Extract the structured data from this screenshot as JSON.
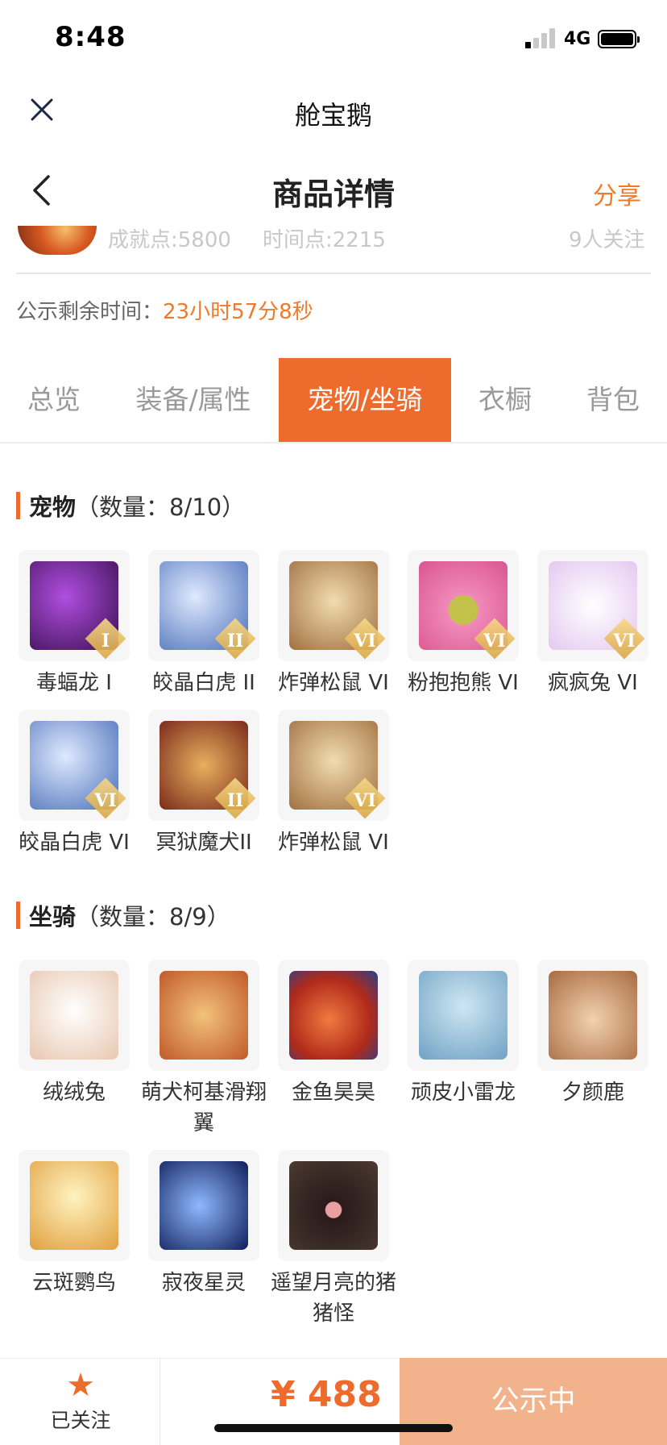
{
  "status_bar": {
    "time": "8:48",
    "network": "4G"
  },
  "app_bar": {
    "title": "舱宝鹅"
  },
  "nav": {
    "title": "商品详情",
    "share": "分享"
  },
  "peek_row": {
    "achievement": "成就点:5800",
    "timepoint": "时间点:2215",
    "followers": "9人关注"
  },
  "publicity": {
    "label": "公示剩余时间：",
    "remaining": "23小时57分8秒"
  },
  "tabs": [
    {
      "label": "总览"
    },
    {
      "label": "装备/属性"
    },
    {
      "label": "宠物/坐骑"
    },
    {
      "label": "衣橱"
    },
    {
      "label": "背包"
    }
  ],
  "pets": {
    "title": "宠物",
    "count": "（数量：8/10）",
    "items": [
      {
        "name": "毒蝠龙 I",
        "badge": "I",
        "color": "#7a2d9e"
      },
      {
        "name": "皎晶白虎 II",
        "badge": "II",
        "color": "#8fb3e8"
      },
      {
        "name": "炸弹松鼠 VI",
        "badge": "VI",
        "color": "#c9a06a"
      },
      {
        "name": "粉抱抱熊 VI",
        "badge": "VI",
        "color": "#e676a8"
      },
      {
        "name": "疯疯兔 VI",
        "badge": "VI",
        "color": "#e9d9ef"
      },
      {
        "name": "皎晶白虎 VI",
        "badge": "VI",
        "color": "#8fb3e8"
      },
      {
        "name": "冥狱魔犬II",
        "badge": "II",
        "color": "#b0402a"
      },
      {
        "name": "炸弹松鼠 VI",
        "badge": "VI",
        "color": "#c9a06a"
      }
    ]
  },
  "mounts": {
    "title": "坐骑",
    "count": "（数量：8/9）",
    "items": [
      {
        "name": "绒绒兔",
        "color": "#f0e4dc"
      },
      {
        "name": "萌犬柯基滑翔翼",
        "color": "#e6a35a"
      },
      {
        "name": "金鱼昊昊",
        "color": "#e0552e"
      },
      {
        "name": "顽皮小雷龙",
        "color": "#9fc8e0"
      },
      {
        "name": "夕颜鹿",
        "color": "#d9a77a"
      },
      {
        "name": "云斑鹦鸟",
        "color": "#efd27a"
      },
      {
        "name": "寂夜星灵",
        "color": "#1f3d8a"
      },
      {
        "name": "遥望月亮的猪猪怪",
        "color": "#3a2a2a"
      }
    ]
  },
  "bottom": {
    "follow_label": "已关注",
    "price": "¥ 488",
    "status": "公示中"
  },
  "colors": {
    "accent": "#ee6b2e",
    "share": "#f07a2a",
    "status_button": "#f2b28c"
  },
  "icons": [
    "close-icon",
    "back-icon",
    "star-icon",
    "signal-icon",
    "battery-icon"
  ]
}
